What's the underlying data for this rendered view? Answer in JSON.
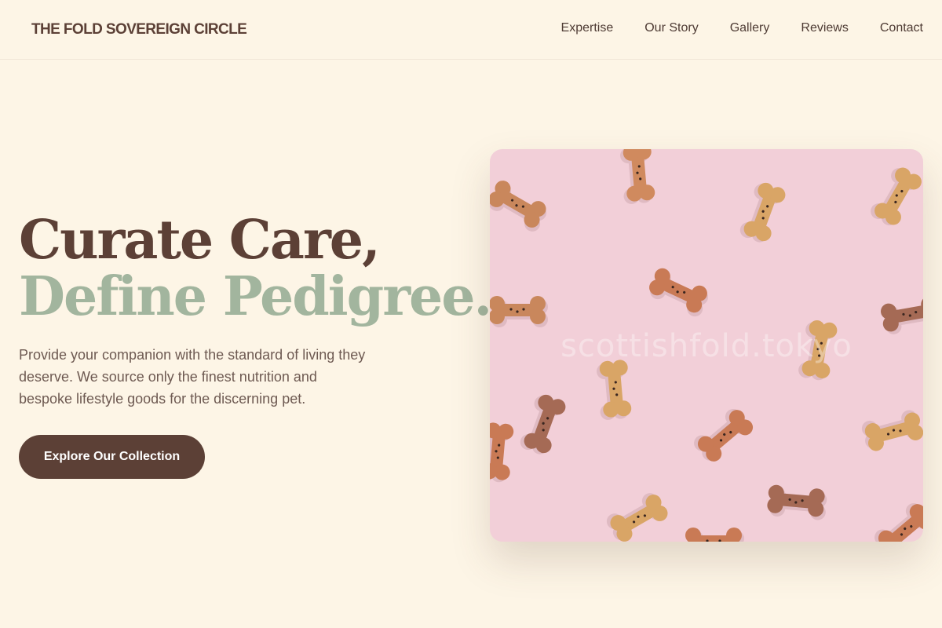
{
  "header": {
    "brand": "THE FOLD SOVEREIGN CIRCLE",
    "nav": [
      "Expertise",
      "Our Story",
      "Gallery",
      "Reviews",
      "Contact"
    ]
  },
  "hero": {
    "headline_line1": "Curate Care,",
    "headline_line2": "Define Pedigree.",
    "lead": "Provide your companion with the standard of living they deserve. We source only the finest nutrition and bespoke lifestyle goods for the discerning pet.",
    "cta_label": "Explore Our Collection",
    "image_watermark": "scottishfold.tokyo"
  },
  "colors": {
    "background": "#fdf5e6",
    "brown": "#5c4036",
    "sage": "#a2b59e",
    "image_bg": "#f2cfd8"
  }
}
